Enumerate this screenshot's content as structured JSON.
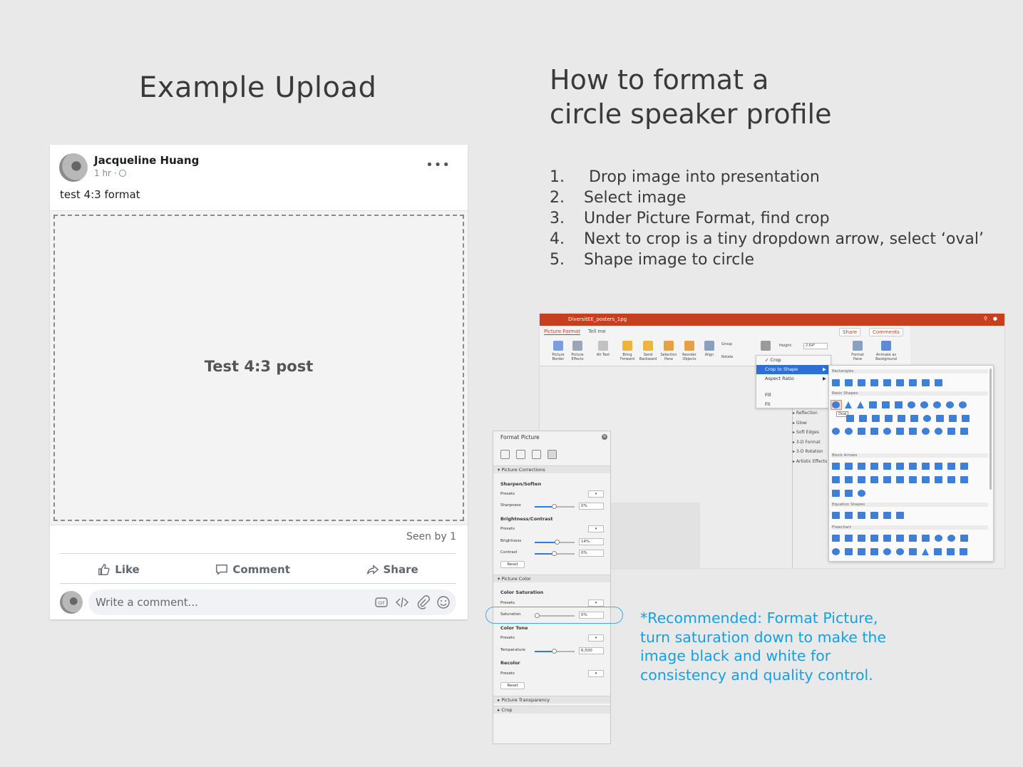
{
  "left_heading": "Example Upload",
  "right_heading_line1": "How to format a",
  "right_heading_line2": "circle speaker profile",
  "steps": [
    {
      "num": "1.",
      "text": " Drop image into presentation"
    },
    {
      "num": "2.",
      "text": "Select image"
    },
    {
      "num": "3.",
      "text": "Under Picture Format, find crop"
    },
    {
      "num": "4.",
      "text": "Next to crop is a tiny dropdown arrow, select ‘oval’"
    },
    {
      "num": "5.",
      "text": "Shape image to circle"
    }
  ],
  "post": {
    "author": "Jacqueline Huang",
    "time": "1 hr ·",
    "more": "•••",
    "caption": "test 4:3 format",
    "media_label": "Test 4:3 post",
    "seen": "Seen by 1",
    "like_label": "Like",
    "comment_label": "Comment",
    "share_label": "Share",
    "comment_placeholder": "Write a comment..."
  },
  "ppt": {
    "file_title": "DiversitEE_posters_1pg",
    "tab_picture_format": "Picture Format",
    "tab_tell_me": "Tell me",
    "share": "Share",
    "comments": "Comments",
    "ribbon": [
      {
        "label": "Picture Border"
      },
      {
        "label": "Picture Effects"
      },
      {
        "label": "Alt Text"
      },
      {
        "label": "Bring Forward"
      },
      {
        "label": "Send Backward"
      },
      {
        "label": "Selection Pane"
      },
      {
        "label": "Reorder Objects"
      },
      {
        "label": "Align"
      },
      {
        "label": "Group"
      },
      {
        "label": "Rotate"
      },
      {
        "label": "Height:"
      },
      {
        "label": "2.64\""
      },
      {
        "label": "Format Pane"
      },
      {
        "label": "Animate as Background"
      }
    ],
    "crop_menu": [
      "Crop",
      "Crop to Shape",
      "Aspect Ratio",
      "Fill",
      "Fit"
    ],
    "side_list": [
      "Reflection",
      "Glow",
      "Soft Edges",
      "3-D Format",
      "3-D Rotation",
      "Artistic Effects"
    ],
    "shape_categories": [
      "Rectangles",
      "Basic Shapes",
      "Block Arrows",
      "Equation Shapes",
      "Flowchart"
    ],
    "oval_tooltip": "Oval"
  },
  "format_picture": {
    "title": "Format Picture",
    "sec_corrections": "Picture Corrections",
    "sharpen": "Sharpen/Soften",
    "presets": "Presets",
    "sharpness": "Sharpness",
    "sharpness_val": "0%",
    "bright_contrast": "Brightness/Contrast",
    "brightness": "Brightness",
    "brightness_val": "14%",
    "contrast": "Contrast",
    "contrast_val": "0%",
    "reset": "Reset",
    "sec_color": "Picture Color",
    "color_saturation": "Color Saturation",
    "saturation": "Saturation",
    "saturation_val": "0%",
    "color_tone": "Color Tone",
    "temperature": "Temperature",
    "temperature_val": "6,500",
    "recolor": "Recolor",
    "sec_transparency": "Picture Transparency",
    "sec_crop": "Crop"
  },
  "note": "*Recommended: Format Picture, turn saturation  down to make the image black and white for consistency and quality control.",
  "colors": {
    "accent_blue": "#14a1e3",
    "ppt_red": "#c6401f"
  }
}
